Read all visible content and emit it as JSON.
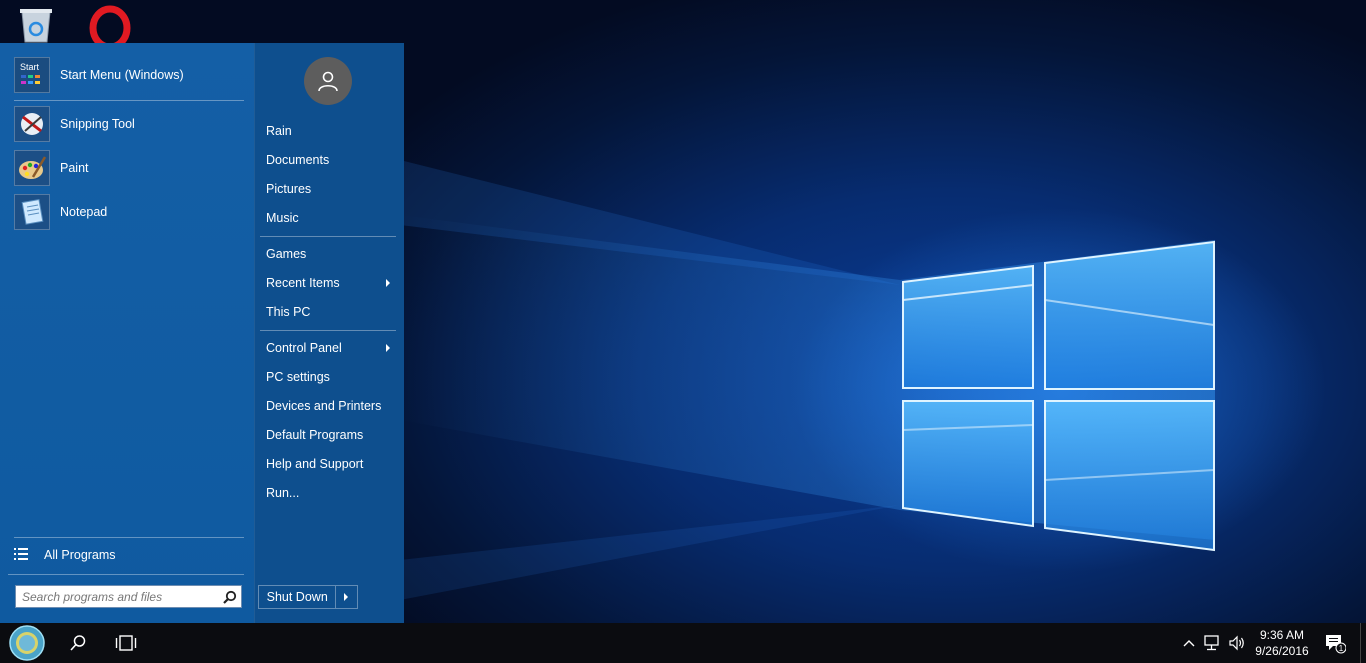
{
  "desktop": {
    "icons": [
      {
        "name": "Recycle Bin",
        "icon": "recycle-bin-icon"
      },
      {
        "name": "Opera",
        "icon": "opera-icon"
      }
    ],
    "accent_color": "#0f5aa0"
  },
  "start_menu": {
    "pinned": [
      {
        "label": "Start Menu (Windows)",
        "icon": "start-menu-app-icon",
        "icon_text": "Start"
      },
      {
        "label": "Snipping Tool",
        "icon": "snipping-tool-icon"
      },
      {
        "label": "Paint",
        "icon": "paint-icon"
      },
      {
        "label": "Notepad",
        "icon": "notepad-icon"
      }
    ],
    "all_programs_label": "All Programs",
    "search_placeholder": "Search programs and files",
    "right_items": [
      {
        "label": "Rain"
      },
      {
        "label": "Documents"
      },
      {
        "label": "Pictures"
      },
      {
        "label": "Music"
      },
      {
        "label": "Games"
      },
      {
        "label": "Recent Items",
        "submenu": true
      },
      {
        "label": "This PC"
      },
      {
        "label": "Control Panel",
        "submenu": true
      },
      {
        "label": "PC settings"
      },
      {
        "label": "Devices and Printers"
      },
      {
        "label": "Default Programs"
      },
      {
        "label": "Help and Support"
      },
      {
        "label": "Run..."
      }
    ],
    "shutdown_label": "Shut Down"
  },
  "taskbar": {
    "time": "9:36 AM",
    "date": "9/26/2016",
    "notification_count": "1",
    "tray_icons": [
      "chevron-up-icon",
      "network-icon",
      "volume-icon",
      "notification-center-icon"
    ]
  }
}
